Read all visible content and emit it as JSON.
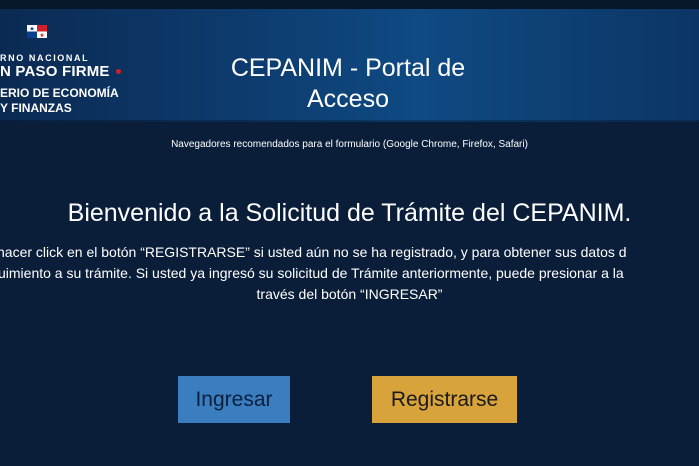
{
  "header": {
    "gov_line": "RNO NACIONAL",
    "slogan": "N PASO FIRME",
    "ministry_line1": "ERIO DE ECONOMÍA",
    "ministry_line2": "Y FINANZAS",
    "title_line1": "CEPANIM - Portal de",
    "title_line2": "Acceso"
  },
  "notice": {
    "browsers": "Navegadores recomendados para el formulario (Google Chrome, Firefox, Safari)"
  },
  "main": {
    "welcome": "Bienvenido a la Solicitud de Trámite del CEPANIM.",
    "instruction_line1": "hacer click en el botón “REGISTRARSE” si usted aún no se ha registrado, y para obtener sus datos d",
    "instruction_line2": "uimiento a su trámite. Si usted ya ingresó su solicitud de Trámite anteriormente, puede presionar a la",
    "instruction_line3": "través del botón “INGRESAR”"
  },
  "buttons": {
    "ingresar": "Ingresar",
    "registrarse": "Registrarse"
  },
  "colors": {
    "background": "#0a1e3a",
    "header": "#0f4a82",
    "ingresar_button": "#3a7ec0",
    "registrarse_button": "#d7a33a",
    "flag_red": "#d0202a",
    "flag_blue": "#0a3e8f"
  }
}
